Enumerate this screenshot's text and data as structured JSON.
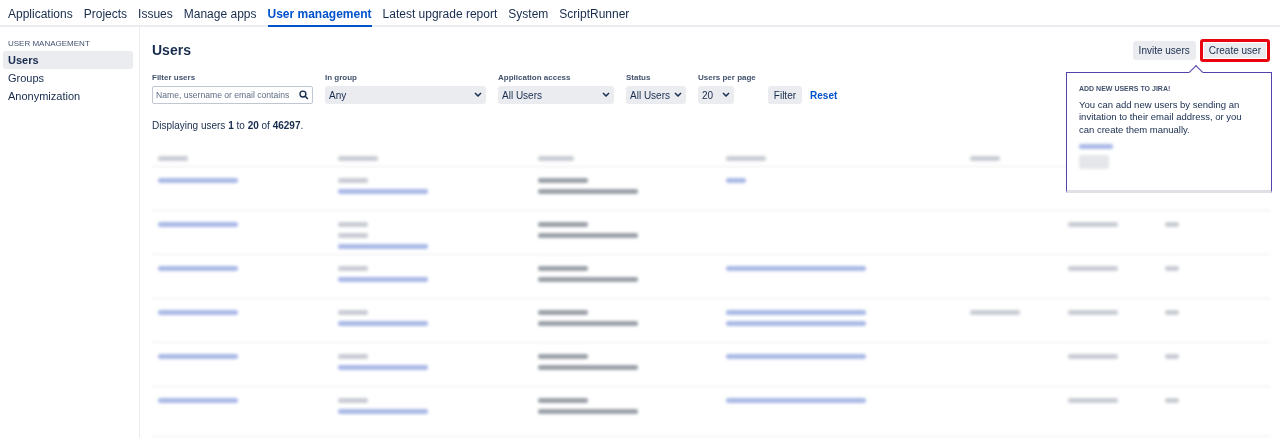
{
  "nav": {
    "tabs": [
      {
        "label": "Applications",
        "selected": false
      },
      {
        "label": "Projects",
        "selected": false
      },
      {
        "label": "Issues",
        "selected": false
      },
      {
        "label": "Manage apps",
        "selected": false
      },
      {
        "label": "User management",
        "selected": true
      },
      {
        "label": "Latest upgrade report",
        "selected": false
      },
      {
        "label": "System",
        "selected": false
      },
      {
        "label": "ScriptRunner",
        "selected": false
      }
    ]
  },
  "sidebar": {
    "heading": "USER MANAGEMENT",
    "items": [
      {
        "label": "Users",
        "selected": true
      },
      {
        "label": "Groups",
        "selected": false
      },
      {
        "label": "Anonymization",
        "selected": false
      }
    ]
  },
  "page": {
    "title": "Users",
    "actions": [
      {
        "label": "Invite users",
        "highlighted": false
      },
      {
        "label": "Create user",
        "highlighted": true
      }
    ],
    "filters": {
      "filter_users": {
        "label": "Filter users",
        "placeholder": "Name, username or email contains"
      },
      "in_group": {
        "label": "In group",
        "value": "Any"
      },
      "application_access": {
        "label": "Application access",
        "value": "All Users"
      },
      "status": {
        "label": "Status",
        "value": "All Users"
      },
      "users_per_page": {
        "label": "Users per page",
        "value": "20"
      },
      "filter_button": "Filter",
      "reset_link": "Reset"
    },
    "summary": "Displaying users **1** to **20** of **46297**."
  },
  "popup": {
    "heading": "ADD NEW USERS TO JIRA!",
    "body": "You can add new users by sending an invitation to their email address, or you can create them manually."
  }
}
